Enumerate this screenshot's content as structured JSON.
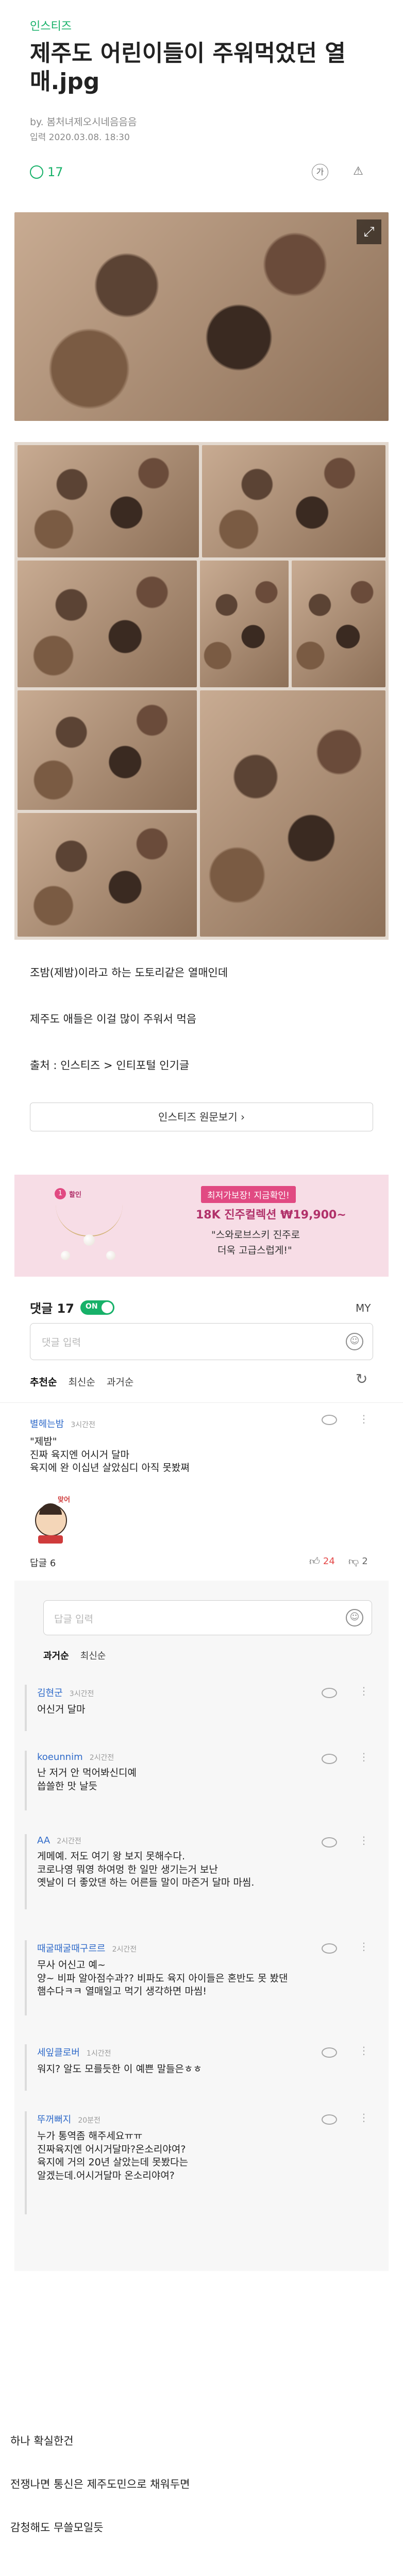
{
  "source": "인스티즈",
  "title": "제주도 어린이들이 주워먹었던 열매.jpg",
  "byline": "by. 봄처녀제오시네음음음",
  "date": "입력 2020.03.08. 18:30",
  "comment_count_top": "17",
  "icons": {
    "comment": "comment-icon",
    "font": "font-size-icon",
    "alert": "report-icon",
    "expand": "expand-icon",
    "eye": "view-icon",
    "more": "more-icon",
    "like": "thumbs-up-icon",
    "dislike": "thumbs-down-icon",
    "refresh": "refresh-icon",
    "emoji": "smiley-icon",
    "chevron": "chevron-right-icon"
  },
  "body": {
    "line1": "조밤(제밤)이라고 하는 도토리같은 열매인데",
    "line2": "제주도 애들은 이걸 많이 주워서 먹음",
    "line3": "출처 : 인스티즈 > 인티포털 인기글",
    "source_button": "인스티즈 원문보기 ›"
  },
  "ad": {
    "badge_num": "1",
    "badge_word": "할인",
    "tag1": "최저가보장! 지금확인!",
    "price_line": "18K 진주컬렉션 ₩19,900~",
    "tag3": "\"스와로브스키 진주로",
    "tag4": "더욱 고급스럽게!\""
  },
  "comments_header": {
    "label": "댓글 17",
    "toggle": "ON",
    "my": "MY",
    "placeholder": "댓글 입력",
    "sort": [
      "추천순",
      "최신순",
      "과거순"
    ]
  },
  "top_comment": {
    "name": "별헤는밤",
    "time": "3시간전",
    "lines": [
      "\"제밤\"",
      "진짜 육지엔 어시거 달마",
      "육지에 완 이십년 살았심디 아직 못봤쪄"
    ],
    "reply_label": "답글 6",
    "likes": "24",
    "dislikes": "2",
    "sticker_text": "맞어"
  },
  "reply_area": {
    "placeholder": "답글 입력",
    "sort": [
      "과거순",
      "최신순"
    ]
  },
  "replies": [
    {
      "name": "김현군",
      "time": "3시간전",
      "lines": [
        "어신거 달마"
      ]
    },
    {
      "name": "koeunnim",
      "time": "2시간전",
      "lines": [
        "난 저거 안 먹어봐신디예",
        "씁쓸한 맛 날듯"
      ]
    },
    {
      "name": "AA",
      "time": "2시간전",
      "lines": [
        "게메예. 저도 여기 왕 보지 못해수다.",
        "코로나영 뭐영 하여멍 한 일만 생기는거 보난",
        "옛날이 더 좋았댄 하는 어른들 말이 마즌거 달마 마씸."
      ]
    },
    {
      "name": "때굴때굴때구르르",
      "time": "2시간전",
      "lines": [
        "무사 어신고 예~",
        "양~ 비파 알아점수과?? 비파도 육지 아이들은 혼반도 못 봤댄",
        "햄수다ㅋㅋ 열매일고 먹기 생각하면 마씸!"
      ]
    },
    {
      "name": "세잎클로버",
      "time": "1시간전",
      "lines": [
        "워지? 알도 모를듯한 이 예쁜 말들은ㅎㅎ"
      ]
    },
    {
      "name": "뚜꺼뻐지",
      "time": "20분전",
      "lines": [
        "누가 통역좀 해주세요ㅠㅠ",
        "진짜육지엔 어시거달마?온소리야여?",
        "육지에 거의 20년 살았는데 못봤다는",
        "알겠는데.어시거달마 온소리야여?"
      ]
    }
  ],
  "footer": {
    "line1": "하나 확실한건",
    "line2": "전쟁나면 통신은 제주도민으로 채워두면",
    "line3": "감청해도 무쓸모일듯"
  },
  "colors": {
    "accent_green": "#17b169",
    "link_blue": "#2f6ac9",
    "like_red": "#e44848",
    "ad_bg": "#f7dde6"
  }
}
